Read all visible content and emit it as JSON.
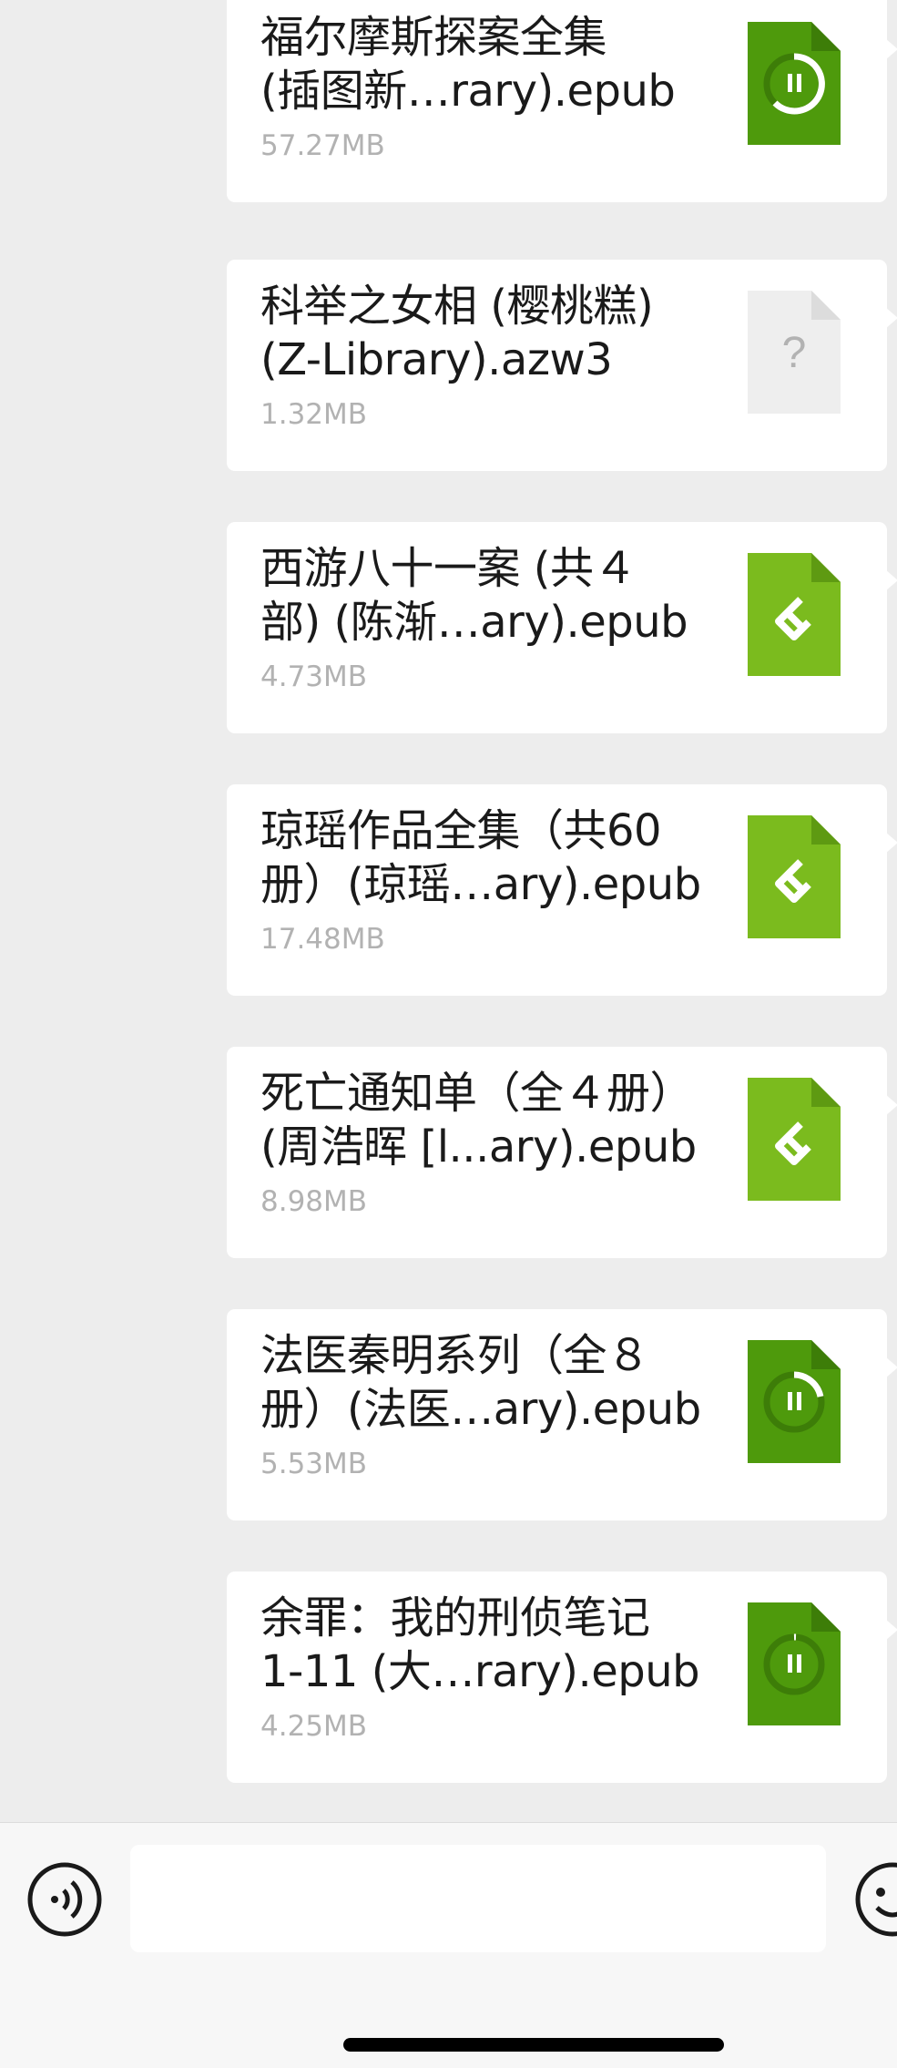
{
  "messages": [
    {
      "name": "福尔摩斯探案全集\n(插图新…rary).epub",
      "size": "57.27MB",
      "icon": "downloading-file-icon"
    },
    {
      "name": "科举之女相 (樱桃糕)\n(Z-Library).azw3",
      "size": "1.32MB",
      "icon": "unknown-file-icon"
    },
    {
      "name": "西游八十一案 (共４\n部) (陈渐…ary).epub",
      "size": "4.73MB",
      "icon": "epub-file-icon"
    },
    {
      "name": "琼瑶作品全集（共60\n册）(琼瑶…ary).epub",
      "size": "17.48MB",
      "icon": "epub-file-icon"
    },
    {
      "name": "死亡通知单（全４册）\n(周浩晖 [l...ary).epub",
      "size": "8.98MB",
      "icon": "epub-file-icon"
    },
    {
      "name": "法医秦明系列（全８\n册）(法医…ary).epub",
      "size": "5.53MB",
      "icon": "downloading-file-icon"
    },
    {
      "name": "余罪：我的刑侦笔记\n1-11 (大…rary).epub",
      "size": "4.25MB",
      "icon": "downloading-file-icon"
    }
  ],
  "input_bar": {
    "voice_icon": "voice-icon",
    "emoji_icon": "emoji-icon",
    "text_value": ""
  },
  "colors": {
    "background": "#ededed",
    "bubble": "#ffffff",
    "epub_green": "#7bbb1e",
    "downloading_green": "#4e9a0c",
    "unknown_gray": "#eeeeee",
    "size_text": "#b2b2b2"
  }
}
